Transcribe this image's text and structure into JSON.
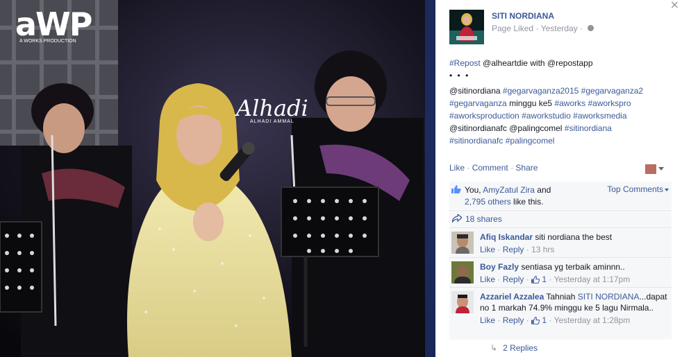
{
  "photo": {
    "logo_text": "aWP",
    "logo_tagline": "A WORKS PRODUCTION",
    "signature": "Alhadi",
    "signature_caption": "ALHADI AMMAL"
  },
  "close_glyph": "×",
  "post": {
    "page_name": "SITI NORDIANA",
    "page_liked": "Page Liked",
    "time": "Yesterday",
    "line1_hashtag": "#Repost",
    "line1_rest": " @alheartdie with @repostapp",
    "dots": "• • •",
    "body_lines": [
      {
        "segments": [
          {
            "t": "@sitinordiana ",
            "link": false
          },
          {
            "t": "#gegarvaganza2015",
            "link": true
          },
          {
            "t": " ",
            "link": false
          },
          {
            "t": "#gegarvaganza2",
            "link": true
          }
        ]
      },
      {
        "segments": [
          {
            "t": "#gegarvaganza",
            "link": true
          },
          {
            "t": " minggu ke5 ",
            "link": false
          },
          {
            "t": "#aworks",
            "link": true
          },
          {
            "t": " ",
            "link": false
          },
          {
            "t": "#aworkspro",
            "link": true
          }
        ]
      },
      {
        "segments": [
          {
            "t": "#aworksproduction",
            "link": true
          },
          {
            "t": " ",
            "link": false
          },
          {
            "t": "#aworkstudio",
            "link": true
          },
          {
            "t": " ",
            "link": false
          },
          {
            "t": "#aworksmedia",
            "link": true
          }
        ]
      },
      {
        "segments": [
          {
            "t": "@sitinordianafc @palingcomel ",
            "link": false
          },
          {
            "t": "#sitinordiana",
            "link": true
          }
        ]
      },
      {
        "segments": [
          {
            "t": "#sitinordianafc",
            "link": true
          },
          {
            "t": " ",
            "link": false
          },
          {
            "t": "#palingcomel",
            "link": true
          }
        ]
      }
    ]
  },
  "actions": {
    "like": "Like",
    "comment": "Comment",
    "share": "Share",
    "sep": "·"
  },
  "likes": {
    "you": "You, ",
    "friend": "AmyZatul Zira",
    "and": " and",
    "others": "2,795 others",
    "like_this": " like this.",
    "top_comments": "Top Comments"
  },
  "shares": {
    "label": "18 shares"
  },
  "comments": [
    {
      "author": "Afiq Iskandar",
      "text": " siti nordiana the best",
      "like": "Like",
      "reply": "Reply",
      "likes_count": "",
      "time": "13 hrs"
    },
    {
      "author": "Boy Fazly",
      "text": " sentiasa yg terbaik aminnn..",
      "like": "Like",
      "reply": "Reply",
      "likes_count": "1",
      "time": "Yesterday at 1:17pm"
    },
    {
      "author": "Azzariel Azzalea",
      "text_pre": " Tahniah ",
      "mention": "SITI NORDIANA",
      "text_post": "...dapat no 1 markah 74.9% minggu ke 5 lagu Nirmala..",
      "like": "Like",
      "reply": "Reply",
      "likes_count": "1",
      "time": "Yesterday at 1:28pm"
    }
  ],
  "replies": {
    "label": "2 Replies",
    "arrow": "↳"
  },
  "colors": {
    "link": "#3b5998",
    "muted": "#90949c",
    "ufi_bg": "#f6f7f9",
    "hijab": "#d8b84a",
    "dress": "#efe6a8"
  }
}
